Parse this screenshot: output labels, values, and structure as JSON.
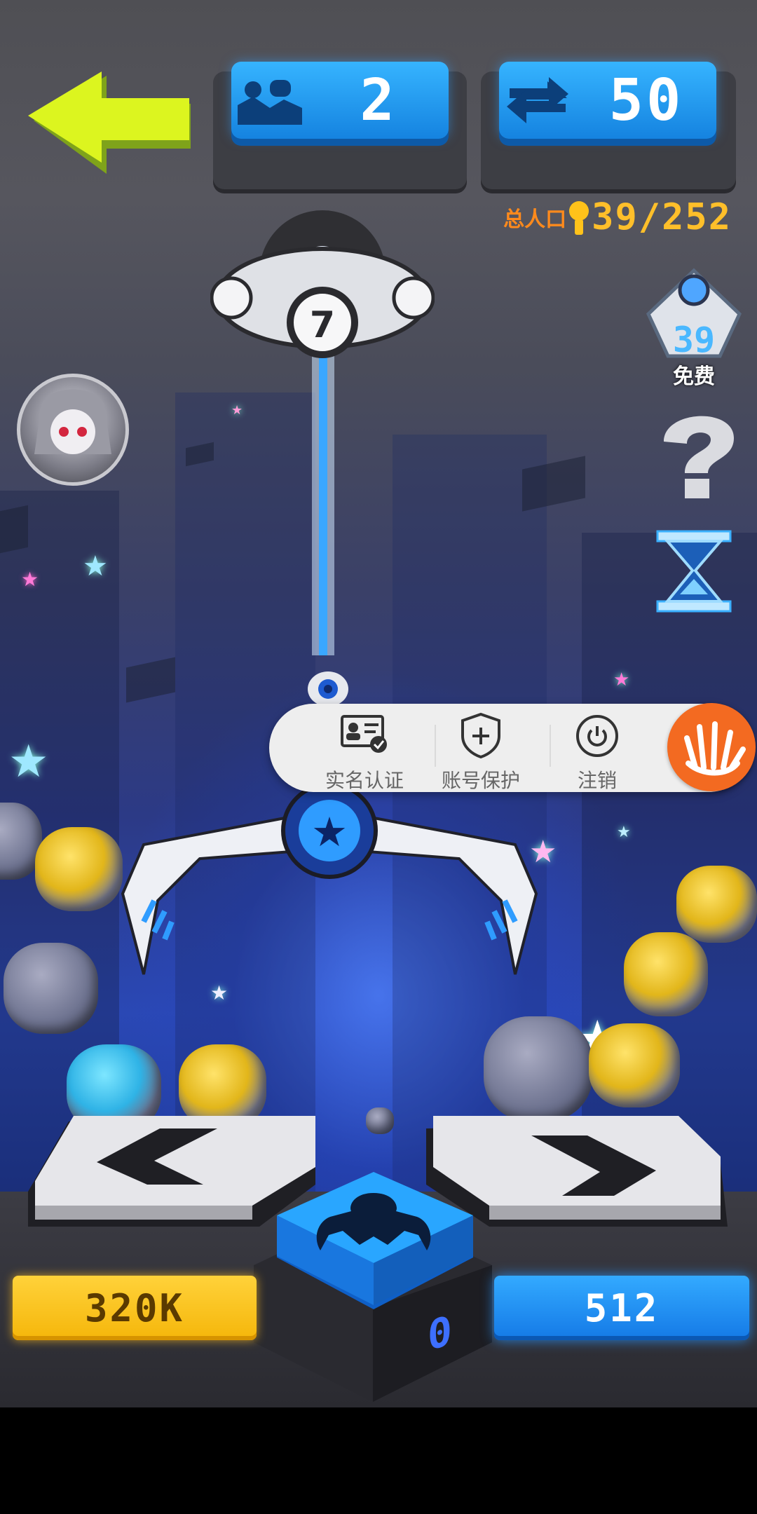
{
  "header": {
    "stage_icon": "landscape-icon",
    "stage_value": "2",
    "swap_icon": "swap-arrows-icon",
    "swap_value": "50"
  },
  "population": {
    "label": "总人口",
    "icon": "person-icon",
    "value": "39/252"
  },
  "side_buttons": {
    "free_count": "39",
    "free_label": "免费",
    "help_icon": "question-icon",
    "timer_icon": "hourglass-icon"
  },
  "float_menu": {
    "items": [
      {
        "label": "实名认证",
        "icon": "id-card-verify-icon"
      },
      {
        "label": "账号保护",
        "icon": "shield-plus-icon"
      },
      {
        "label": "注销",
        "icon": "power-icon"
      }
    ],
    "brand_icon": "hand-logo-icon"
  },
  "bottom": {
    "coins": "320K",
    "gems": "512",
    "summon_count": "0",
    "left_icon": "chevron-left-icon",
    "right_icon": "chevron-right-icon",
    "summon_icon": "claw-icon"
  },
  "colors": {
    "accent_blue": "#1f8ff0",
    "coins_yellow": "#f5b60a",
    "back_arrow": "#d8f21e",
    "population_orange": "#ff8a1c"
  }
}
